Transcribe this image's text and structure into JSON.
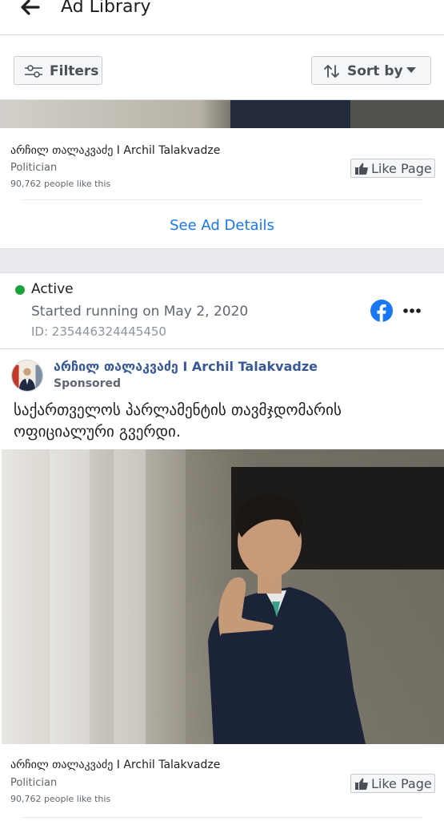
{
  "header": {
    "title": "Ad Library",
    "back_icon": "arrow-left-icon"
  },
  "toolbar": {
    "filters_label": "Filters",
    "filters_icon": "sliders-icon",
    "sort_label": "Sort by",
    "sort_icon": "sort-arrows-icon",
    "sort_caret": "caret-down-icon"
  },
  "previous_ad": {
    "page_name": "არჩილ თალაკვაძე I Archil Talakvadze",
    "category": "Politician",
    "likes": "90,762 people like this",
    "like_button": "Like Page",
    "see_details": "See Ad Details"
  },
  "ad": {
    "status": "Active",
    "status_color": "#1aa33c",
    "started": "Started running on May 2, 2020",
    "id": "ID: 235446324445450",
    "platform_icon": "facebook-icon",
    "more_icon": "more-horizontal-icon",
    "advertiser": "არჩილ თალაკვაძე I Archil Talakvadze",
    "sponsored": "Sponsored",
    "text": "საქართველოს პარლამენტის თავმჯდომარის ოფიციალური გვერდი.",
    "page_name": "არჩილ თალაკვაძე I Archil Talakvadze",
    "category": "Politician",
    "likes": "90,762 people like this",
    "like_button": "Like Page"
  },
  "colors": {
    "link_blue": "#1877f2",
    "advertiser_blue": "#385898",
    "facebook_blue": "#1877f2"
  }
}
